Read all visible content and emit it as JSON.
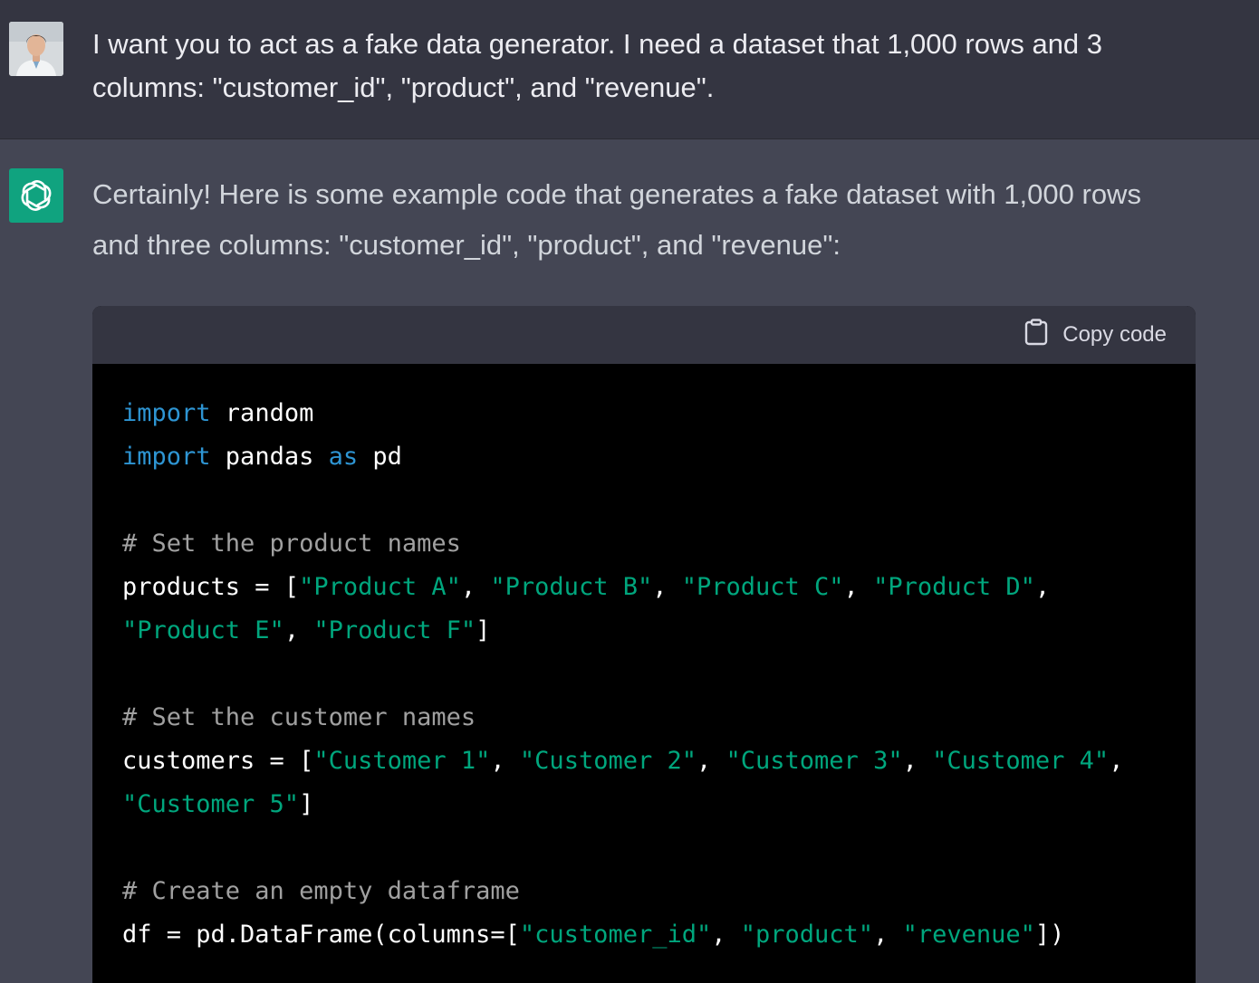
{
  "user_message": {
    "line1": "I want you to act as a fake data generator. I need a dataset that 1,000 rows and 3",
    "line2": "columns: \"customer_id\", \"product\", and \"revenue\"."
  },
  "assistant_message": {
    "line1": "Certainly! Here is some example code that generates a fake dataset with 1,000 rows",
    "line2": "and three columns: \"customer_id\", \"product\", and \"revenue\":"
  },
  "code_block": {
    "copy_label": "Copy code",
    "tokens": {
      "import": "import",
      "as": "as",
      "random": " random",
      "pandas": " pandas ",
      "pd": " pd",
      "comment1": "# Set the product names",
      "products_assign": "products = [",
      "product_a": "\"Product A\"",
      "product_b": "\"Product B\"",
      "product_c": "\"Product C\"",
      "product_d": "\"Product D\"",
      "product_e": "\"Product E\"",
      "product_f": "\"Product F\"",
      "comment2": "# Set the customer names",
      "customers_assign": "customers = [",
      "customer_1": "\"Customer 1\"",
      "customer_2": "\"Customer 2\"",
      "customer_3": "\"Customer 3\"",
      "customer_4": "\"Customer 4\"",
      "customer_5": "\"Customer 5\"",
      "comment3": "# Create an empty dataframe",
      "df_assign": "df = pd.DataFrame(columns=[",
      "col_customer_id": "\"customer_id\"",
      "col_product": "\"product\"",
      "col_revenue": "\"revenue\"",
      "sep": ", ",
      "sep_end": ",",
      "close_bracket": "]",
      "close_call": "])"
    }
  }
}
